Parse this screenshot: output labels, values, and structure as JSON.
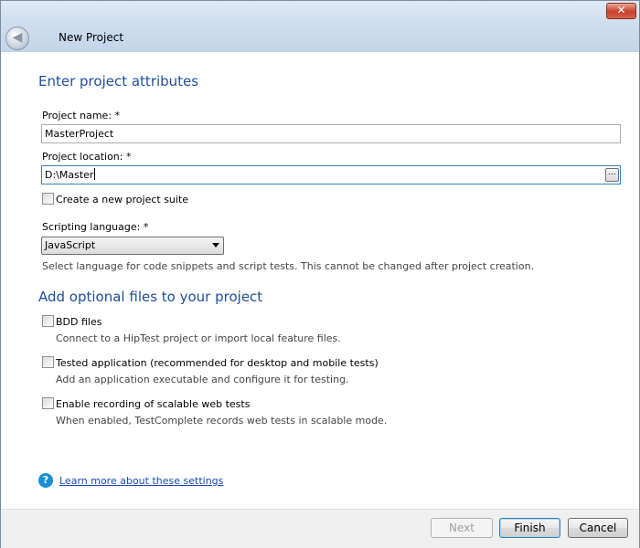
{
  "window": {
    "title": "New Project",
    "close_symbol": "✕",
    "back_symbol": "◀"
  },
  "attributes": {
    "heading": "Enter project attributes",
    "project_name_label": "Project name: *",
    "project_name_value": "MasterProject",
    "project_location_label": "Project location: *",
    "project_location_value": "D:\\Master",
    "browse_label": "...",
    "create_suite_label": "Create a new project suite",
    "create_suite_checked": false,
    "scripting_label": "Scripting language: *",
    "scripting_value": "JavaScript",
    "scripting_hint": "Select language for code snippets and script tests. This cannot be changed after project creation."
  },
  "optional": {
    "heading": "Add optional files to your project",
    "items": [
      {
        "label": "BDD files",
        "hint": "Connect to a HipTest project or import local feature files.",
        "checked": false
      },
      {
        "label": "Tested application (recommended for desktop and mobile tests)",
        "hint": "Add an application executable and configure it for testing.",
        "checked": false
      },
      {
        "label": "Enable recording of scalable web tests",
        "hint": "When enabled, TestComplete records web tests in scalable mode.",
        "checked": false
      }
    ]
  },
  "help": {
    "icon": "?",
    "link": "Learn more about these settings"
  },
  "footer": {
    "next_label": "Next",
    "finish_label": "Finish",
    "cancel_label": "Cancel"
  },
  "colors": {
    "heading": "#1f4e99",
    "link": "#1a49b3",
    "help_icon": "#1b8fd6"
  }
}
